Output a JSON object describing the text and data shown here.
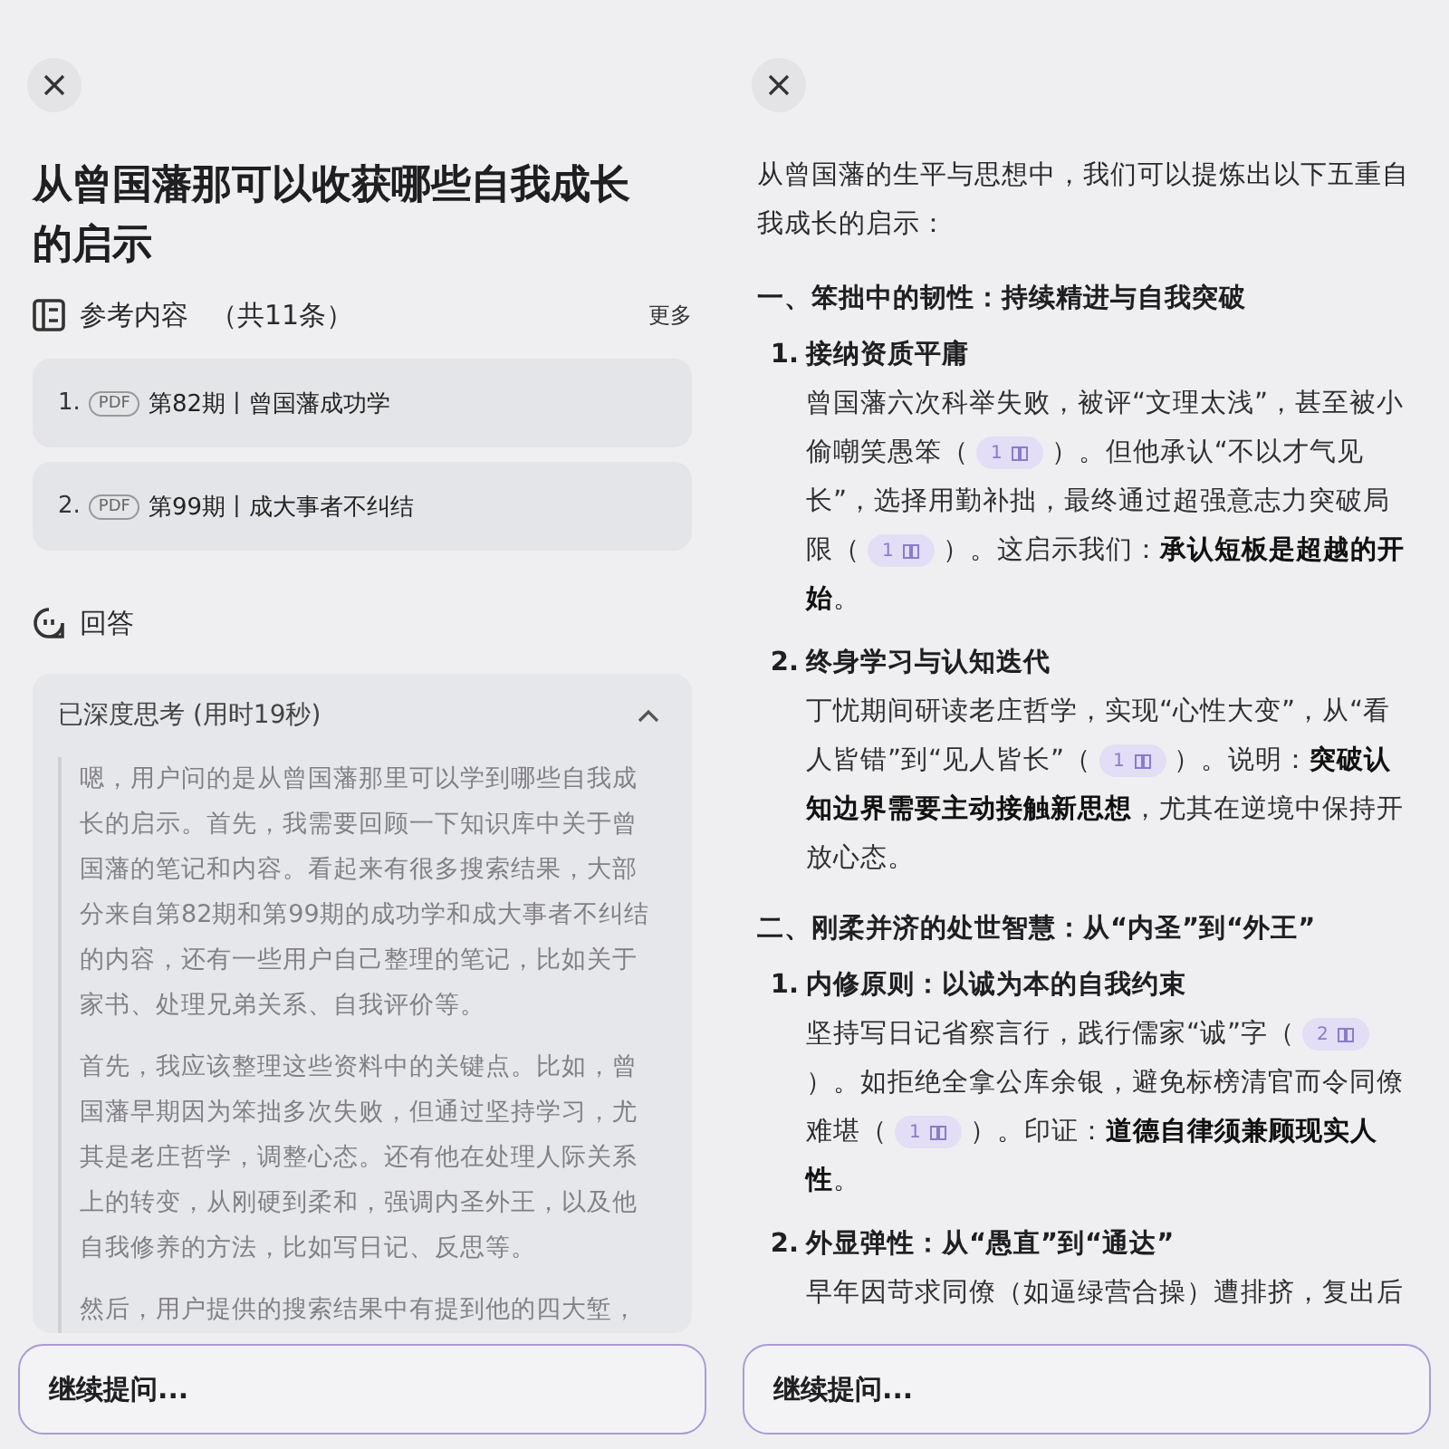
{
  "screens": [
    {
      "kind": "question",
      "title": "从曾国藩那可以收获哪些自我成长的启示",
      "references": {
        "heading": "参考内容",
        "count": "（共11条）",
        "more": "更多",
        "items": [
          {
            "number": "1.",
            "badge": "PDF",
            "title": "第82期丨曾国藩成功学"
          },
          {
            "number": "2.",
            "badge": "PDF",
            "title": "第99期丨成大事者不纠结"
          }
        ]
      },
      "answer": {
        "heading": "回答"
      },
      "thinking": {
        "label": "已深度思考 (用时19秒)",
        "expanded": true,
        "paragraphs": [
          "嗯，用户问的是从曾国藩那里可以学到哪些自我成长的启示。首先，我需要回顾一下知识库中关于曾国藩的笔记和内容。看起来有很多搜索结果，大部分来自第82期和第99期的成功学和成大事者不纠结的内容，还有一些用户自己整理的笔记，比如关于家书、处理兄弟关系、自我评价等。",
          "首先，我应该整理这些资料中的关键点。比如，曾国藩早期因为笨拙多次失败，但通过坚持学习，尤其是老庄哲学，调整心态。还有他在处理人际关系上的转变，从刚硬到柔和，强调内圣外王，以及他自我修养的方法，比如写日记、反思等。",
          "然后，用户提供的搜索结果中有提到他的四大堑，"
        ]
      },
      "input": {
        "placeholder": "继续提问..."
      }
    },
    {
      "kind": "answer",
      "intro": "从曾国藩的生平与思想中，我们可以提炼出以下五重自我成长的启示：",
      "sections": [
        {
          "heading": "一、笨拙中的韧性：持续精进与自我突破",
          "items": [
            {
              "number": "1.",
              "title": "接纳资质平庸",
              "body": [
                {
                  "text": "曾国藩六次科举失败，被评“文理太浅”，甚至被小偷嘲笑愚笨（"
                },
                {
                  "cite": "1"
                },
                {
                  "text": "）。但他承认“不以才气见长”，选择用勤补拙，最终通过超强意志力突破局限（"
                },
                {
                  "cite": "1"
                },
                {
                  "text": "）。这启示我们：**承认短板是超越的开始**。"
                }
              ]
            },
            {
              "number": "2.",
              "title": "终身学习与认知迭代",
              "body": [
                {
                  "text": "丁忧期间研读老庄哲学，实现“心性大变”，从“看人皆错”到“见人皆长”（"
                },
                {
                  "cite": "1"
                },
                {
                  "text": "）。说明：**突破认知边界需要主动接触新思想**，尤其在逆境中保持开放心态。"
                }
              ]
            }
          ]
        },
        {
          "heading": "二、刚柔并济的处世智慧：从“内圣”到“外王”",
          "items": [
            {
              "number": "1.",
              "title": "内修原则：以诚为本的自我约束",
              "body": [
                {
                  "text": "坚持写日记省察言行，践行儒家“诚”字（"
                },
                {
                  "cite": "2"
                },
                {
                  "text": "）。如拒绝全拿公库余银，避免标榜清官而令同僚难堪（"
                },
                {
                  "cite": "1"
                },
                {
                  "text": "）。印证：**道德自律须兼顾现实人性**。"
                }
              ]
            },
            {
              "number": "2.",
              "title": "外显弹性：从“愚直”到“通达”",
              "body": [
                {
                  "text": "早年因苛求同僚（如逼绿营合操）遭排挤，复出后"
                }
              ]
            }
          ]
        }
      ],
      "input": {
        "placeholder": "继续提问..."
      }
    }
  ]
}
